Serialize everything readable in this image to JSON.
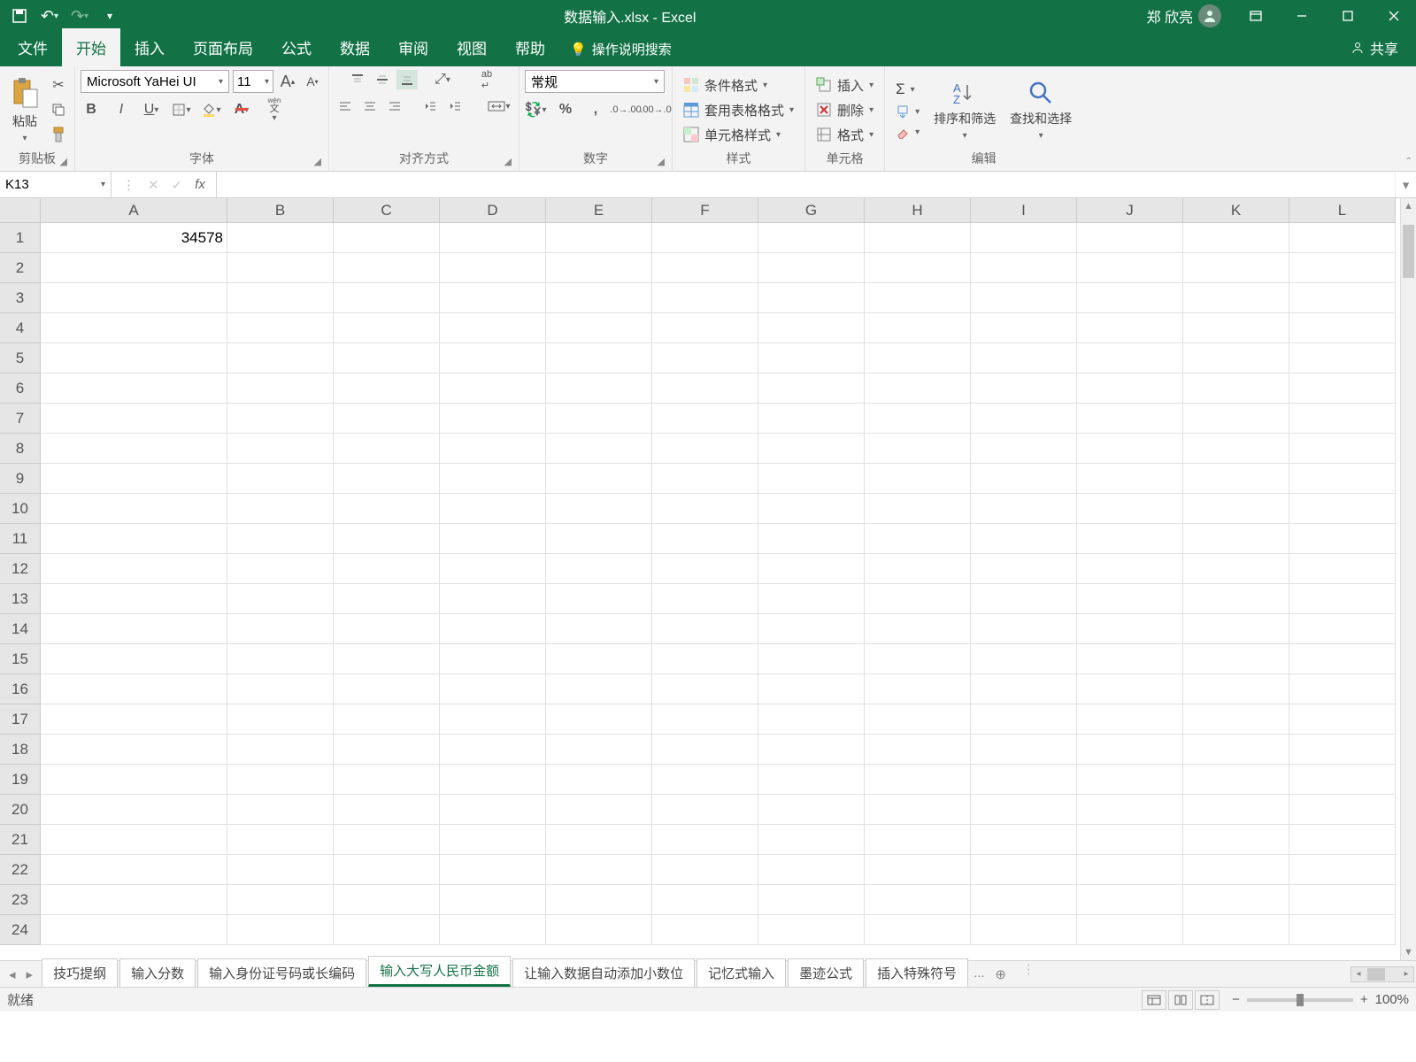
{
  "title": {
    "filename": "数据输入.xlsx",
    "app": "Excel",
    "separator": "  -  "
  },
  "user": {
    "name": "郑 欣亮"
  },
  "qat": {
    "save": "save",
    "undo": "undo",
    "redo": "redo"
  },
  "ribbon_tabs": {
    "file": "文件",
    "home": "开始",
    "insert": "插入",
    "page_layout": "页面布局",
    "formulas": "公式",
    "data": "数据",
    "review": "审阅",
    "view": "视图",
    "help": "帮助",
    "tell_me": "操作说明搜索",
    "share": "共享"
  },
  "ribbon": {
    "clipboard": {
      "paste": "粘贴",
      "label": "剪贴板"
    },
    "font": {
      "name": "Microsoft YaHei UI",
      "size": "11",
      "label": "字体",
      "bold": "B",
      "italic": "I",
      "underline": "U",
      "wen": "wén 文"
    },
    "alignment": {
      "label": "对齐方式"
    },
    "number": {
      "format": "常规",
      "label": "数字"
    },
    "styles": {
      "conditional": "条件格式",
      "format_table": "套用表格格式",
      "cell_styles": "单元格样式",
      "label": "样式"
    },
    "cells": {
      "insert": "插入",
      "delete": "删除",
      "format": "格式",
      "label": "单元格"
    },
    "editing": {
      "sort_filter": "排序和筛选",
      "find_select": "查找和选择",
      "label": "编辑"
    }
  },
  "name_box": "K13",
  "formula": "",
  "columns": [
    "A",
    "B",
    "C",
    "D",
    "E",
    "F",
    "G",
    "H",
    "I",
    "J",
    "K",
    "L"
  ],
  "rows": [
    "1",
    "2",
    "3",
    "4",
    "5",
    "6",
    "7",
    "8",
    "9",
    "10",
    "11",
    "12",
    "13",
    "14",
    "15",
    "16",
    "17",
    "18",
    "19",
    "20",
    "21",
    "22",
    "23",
    "24"
  ],
  "cell_data": {
    "A1": "34578"
  },
  "sheets": {
    "tabs": [
      "技巧提纲",
      "输入分数",
      "输入身份证号码或长编码",
      "输入大写人民币金额",
      "让输入数据自动添加小数位",
      "记忆式输入",
      "墨迹公式",
      "插入特殊符号"
    ],
    "active_index": 3,
    "overflow": "..."
  },
  "status": {
    "ready": "就绪",
    "zoom": "100%"
  }
}
